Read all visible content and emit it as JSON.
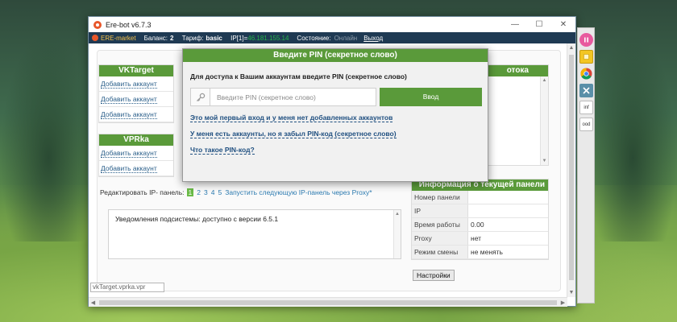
{
  "window": {
    "title": "Ere-bot v6.7.3",
    "minimize": "—",
    "maximize": "☐",
    "close": "✕"
  },
  "topbar": {
    "brand": "ERE-market",
    "balance_label": "Баланс:",
    "balance_value": "2",
    "tariff_label": "Тариф:",
    "tariff_value": "basic",
    "ip_label": "IP[1]=",
    "ip_value": "46.181.155.14",
    "state_label": "Состояние:",
    "state_value": "Онлайн",
    "exit": "Выход"
  },
  "panels": {
    "vktarget": {
      "title": "VKTarget",
      "items": [
        "Добавить аккаунт",
        "Добавить аккаунт",
        "Добавить аккаунт"
      ]
    },
    "vprka": {
      "title": "VPRka",
      "items": [
        "Добавить аккаунт",
        "Добавить аккаунт"
      ]
    },
    "right_title": "отока"
  },
  "edit_panel": {
    "label": "Редактировать IP- панель:",
    "pages": [
      "1",
      "2",
      "3",
      "4",
      "5"
    ],
    "active_page": "1",
    "launch": "Запустить следующую IP-панель через Proxy*"
  },
  "notification": {
    "text": "Уведомления подсистемы: доступно с версии 6.5.1"
  },
  "info": {
    "title": "Информация о текущей панели",
    "rows": [
      {
        "key": "Номер панели",
        "value": ""
      },
      {
        "key": "IP",
        "value": ""
      },
      {
        "key": "Время работы",
        "value": "0.00"
      },
      {
        "key": "Proxy",
        "value": "нет"
      },
      {
        "key": "Режим смены",
        "value": "не менять"
      }
    ]
  },
  "settings_button": "Настройки",
  "bottom_field": "vkTarget.vprka.vpr ",
  "modal": {
    "title": "Введите PIN (секретное слово)",
    "prompt": "Для доступа к Вашим аккаунтам введите PIN (секретное слово)",
    "pin_placeholder": "Введите PIN (секретное слово)",
    "enter_button": "Ввод",
    "link_first_login": "Это мой первый вход и у меня нет добавленных аккаунтов",
    "link_forgot_pin": "У меня есть аккаунты, но я забыл PIN-код (секретное слово)",
    "link_what_is_pin": "Что такое PIN-код?"
  },
  "dock": {
    "items": [
      "pause-icon",
      "note-icon",
      "chrome-icon",
      "tools-icon",
      "inf",
      "ood"
    ],
    "labels": {
      "inf": "inf",
      "ood": "ood"
    }
  },
  "colors": {
    "accent_green": "#5a9a3a",
    "topbar_bg": "#1f3a53",
    "link_blue": "#2b5f8a",
    "online_green": "#26b54a"
  }
}
